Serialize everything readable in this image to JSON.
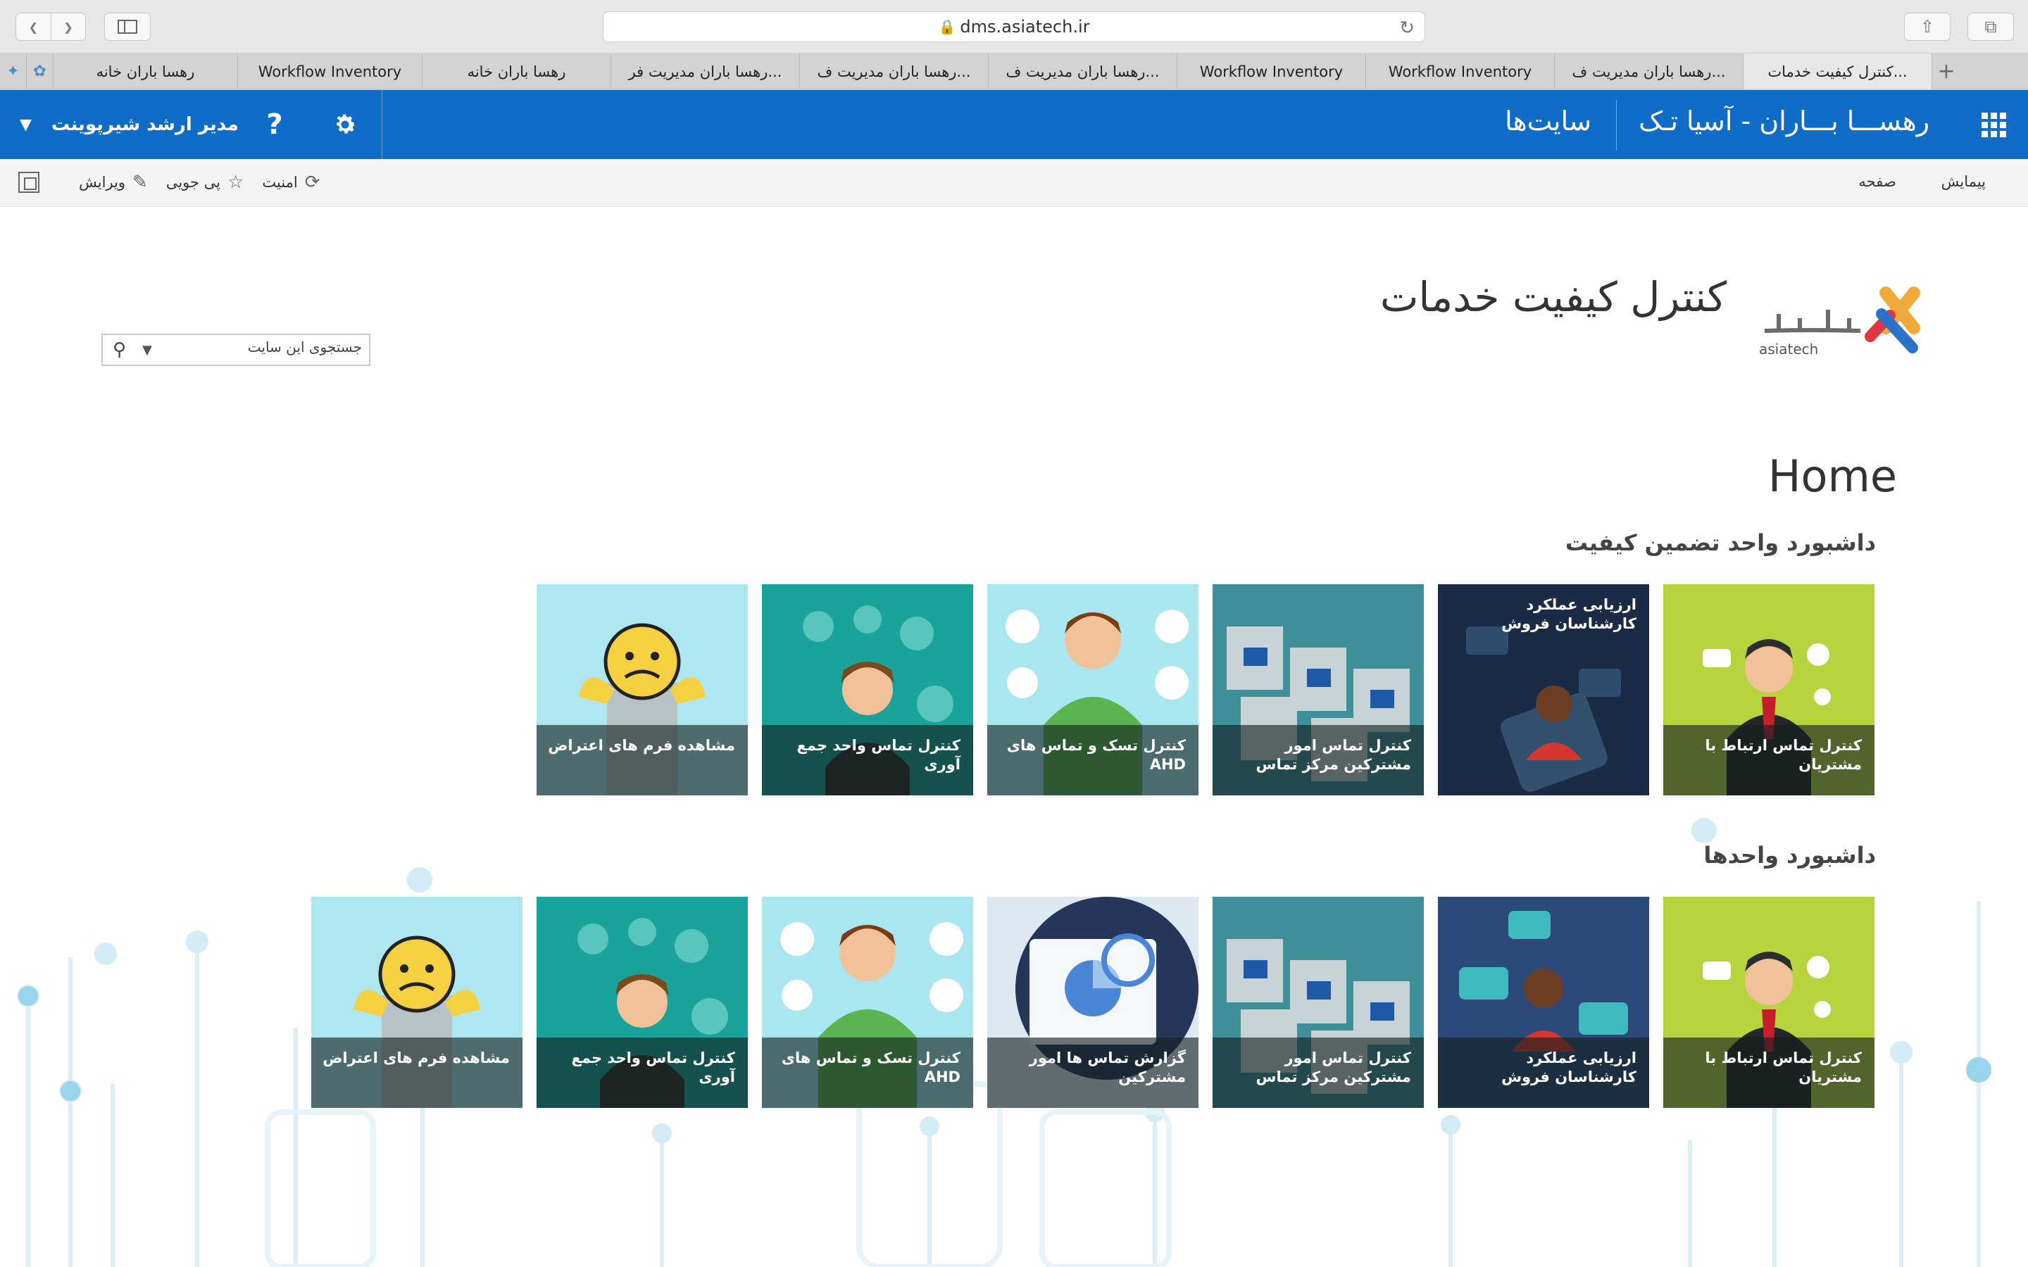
{
  "browser": {
    "url": "dms.asiatech.ir",
    "tabs": [
      "کنترل کیفیت خدمات...",
      "رهسا باران مدیریت ف...",
      "Workflow Inventory",
      "Workflow Inventory",
      "رهسا باران مدیریت ف...",
      "رهسا باران مدیریت ف...",
      "رهسا باران مدیریت فر...",
      "رهسا باران خانه",
      "Workflow Inventory",
      "رهسا باران خانه"
    ]
  },
  "suite_bar": {
    "brand": "رهســـا بـــاران - آسیا تـک",
    "sites": "سایت‌ها",
    "user": "مدیر ارشد شیرپوینت",
    "help": "?",
    "colors": {
      "bar": "#0f6cc7"
    }
  },
  "ribbon": {
    "browse": "پیمایش",
    "page": "صفحه",
    "security": "امنیت",
    "follow": "پی جویی",
    "edit": "ویرایش"
  },
  "site": {
    "title": "کنترل کیفیت خدمات",
    "logo_text": "asiatech",
    "search_placeholder": "جستجوی این سایت"
  },
  "page": {
    "heading": "Home",
    "section1": "داشبورد واحد تضمین کیفیت",
    "section2": "داشبورد واحدها"
  },
  "tiles_row1": [
    {
      "label": "کنترل تماس ارتباط با مشتریان",
      "icon": "manager-icon"
    },
    {
      "label": "ارزیابی عملکرد کارشناسان فروش",
      "icon": "phone-chat-icon"
    },
    {
      "label": "کنترل تماس امور مشترکین مرکز تماس",
      "icon": "call-center-icon"
    },
    {
      "label": "کنترل تسک و تماس های AHD",
      "icon": "support-agent-icon"
    },
    {
      "label": "کنترل تماس واحد جمع آوری",
      "icon": "support-desk-icon"
    },
    {
      "label": "مشاهده فرم های اعتراض",
      "icon": "complaint-icon"
    }
  ],
  "tiles_row2": [
    {
      "label": "کنترل تماس ارتباط با مشتریان",
      "icon": "manager-icon"
    },
    {
      "label": "ارزیابی عملکرد کارشناسان فروش",
      "icon": "phone-chat-icon"
    },
    {
      "label": "کنترل تماس امور مشترکین مرکز تماس",
      "icon": "call-center-icon"
    },
    {
      "label": "گزارش تماس ها امور مشترکین",
      "icon": "report-icon"
    },
    {
      "label": "کنترل تسک و تماس های AHD",
      "icon": "support-agent-icon"
    },
    {
      "label": "کنترل تماس واحد جمع آوری",
      "icon": "support-desk-icon"
    },
    {
      "label": "مشاهده فرم های اعتراض",
      "icon": "complaint-icon"
    }
  ]
}
